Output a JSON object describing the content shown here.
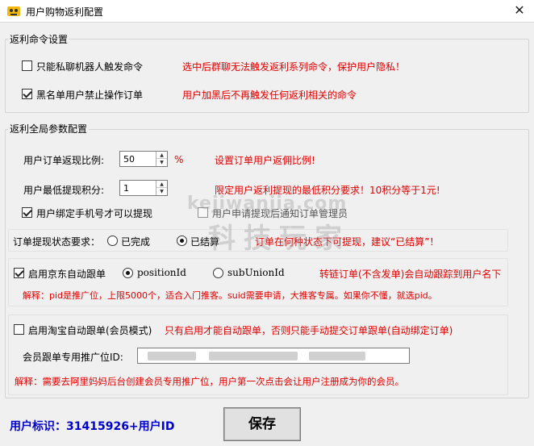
{
  "window": {
    "title": "用户购物返利配置",
    "close_glyph": "✕"
  },
  "rebate_command": {
    "group_title": "返利命令设置",
    "private_only": {
      "label": "只能私聊机器人触发命令",
      "checked": false,
      "hint": "选中后群聊无法触发返利系列命令，保护用户隐私！"
    },
    "blacklist": {
      "label": "黑名单用户禁止操作订单",
      "checked": true,
      "hint": "用户加黑后不再触发任何返利相关的命令"
    }
  },
  "global_params": {
    "group_title": "返利全局参数配置",
    "order_ratio": {
      "label": "用户订单返现比例:",
      "value": "50",
      "unit": "%",
      "hint": "设置订单用户返佣比例!"
    },
    "min_points": {
      "label": "用户最低提现积分:",
      "value": "1",
      "hint": "限定用户返利提现的最低积分要求！10积分等于1元!"
    },
    "phone_bind": {
      "label": "用户绑定手机号才可以提现",
      "checked": true
    },
    "notify_admin": {
      "label": "用户申请提现后通知订单管理员",
      "checked": false
    },
    "withdraw_status": {
      "label": "订单提现状态要求：",
      "options": [
        {
          "label": "已完成",
          "selected": false
        },
        {
          "label": "已结算",
          "selected": true
        }
      ],
      "hint": "订单在何种状态下可提现，建议“已结算”！"
    }
  },
  "jd": {
    "enable_label": "启用京东自动跟单",
    "checked": true,
    "options": [
      {
        "label": "positionId",
        "selected": true
      },
      {
        "label": "subUnionId",
        "selected": false
      }
    ],
    "hint": "转链订单(不含发单)会自动跟踪到用户名下",
    "explain": "解释：pid是推广位，上限5000个，适合入门推客。suid需要申请，大推客专属。如果你不懂，就选pid。"
  },
  "taobao": {
    "enable_label": "启用淘宝自动跟单(会员模式)",
    "checked": false,
    "hint": "只有启用才能自动跟单，否则只能手动提交订单跟单(自动绑定订单)",
    "pid_label": "会员跟单专用推广位ID:",
    "explain": "解释：需要去阿里妈妈后台创建会员专用推广位，用户第一次点击会让用户注册成为你的会员。"
  },
  "footer": {
    "user_id_text": "用户标识：31415926+用户ID",
    "save_label": "保存"
  },
  "watermark": {
    "line1": "kejiwanjia.com",
    "line2": "科技玩家"
  }
}
